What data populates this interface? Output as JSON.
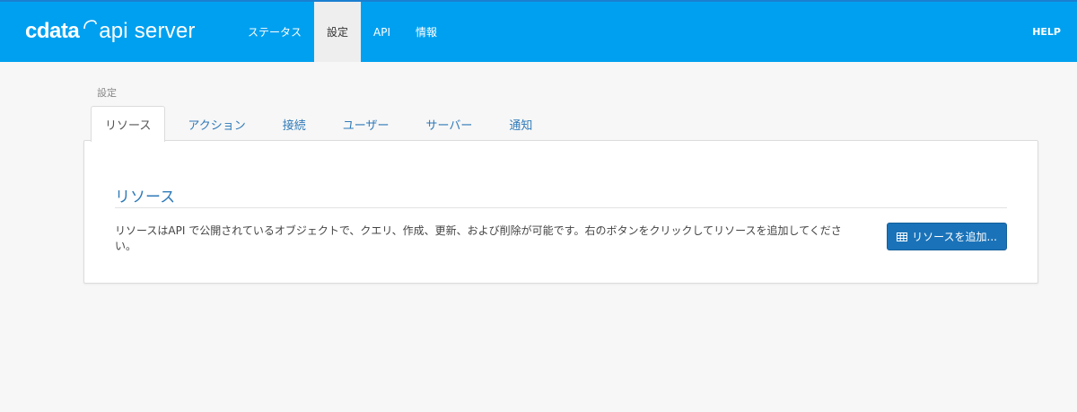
{
  "header": {
    "logo_brand": "cdata",
    "logo_product": "api server",
    "nav": [
      {
        "label": "ステータス",
        "active": false
      },
      {
        "label": "設定",
        "active": true
      },
      {
        "label": "API",
        "active": false
      },
      {
        "label": "情報",
        "active": false
      }
    ],
    "help_label": "HELP"
  },
  "breadcrumb": "設定",
  "tabs": [
    {
      "label": "リソース",
      "active": true
    },
    {
      "label": "アクション",
      "active": false
    },
    {
      "label": "接続",
      "active": false
    },
    {
      "label": "ユーザー",
      "active": false
    },
    {
      "label": "サーバー",
      "active": false
    },
    {
      "label": "通知",
      "active": false
    }
  ],
  "panel": {
    "title": "リソース",
    "description": "リソースはAPI で公開されているオブジェクトで、クエリ、作成、更新、および削除が可能です。右のボタンをクリックしてリソースを追加してください。",
    "add_button_label": "リソースを追加...",
    "add_button_icon": "table-icon"
  },
  "colors": {
    "topbar": "#00a0f0",
    "link": "#2f7ab8",
    "primary_button": "#1a73b9",
    "page_background": "#f7f7f7"
  }
}
